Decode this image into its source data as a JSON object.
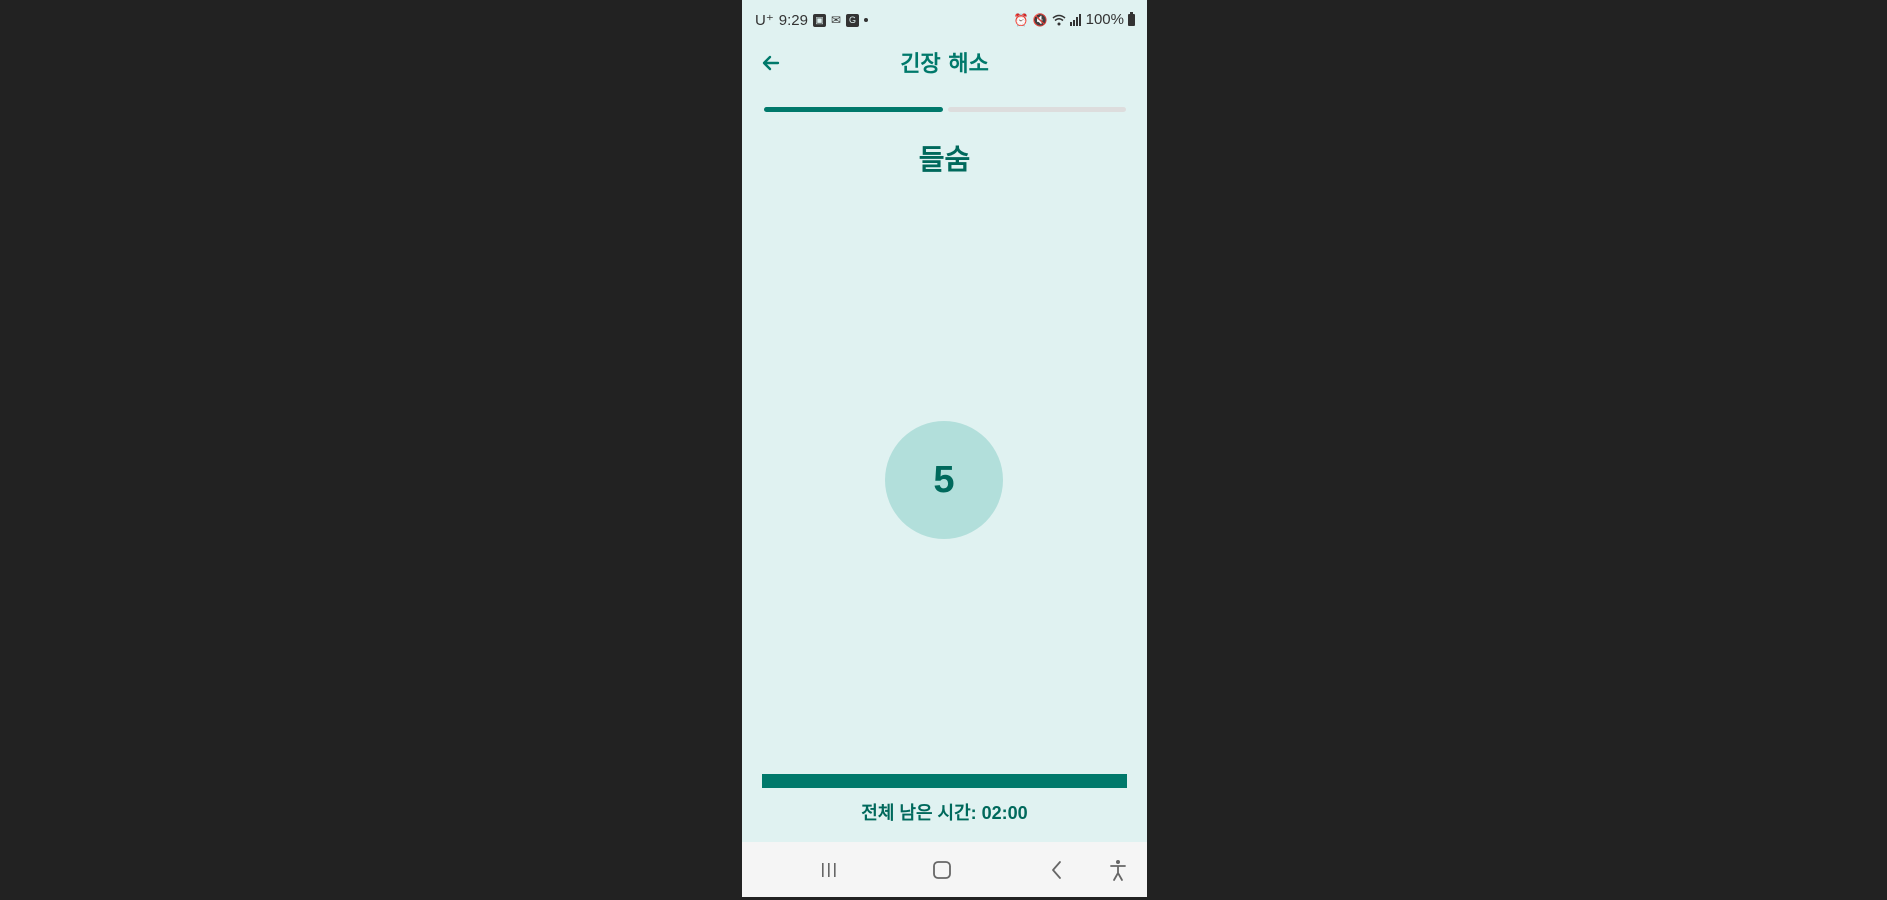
{
  "status_bar": {
    "carrier": "U⁺",
    "time": "9:29",
    "battery": "100%",
    "icons_left": [
      "gallery-icon",
      "mail-icon",
      "app-icon",
      "dot-icon"
    ],
    "icons_right": [
      "alarm-icon",
      "mute-icon",
      "wifi-icon",
      "signal-icon",
      "battery-icon"
    ]
  },
  "app_bar": {
    "title": "긴장 해소",
    "back_icon": "arrow-left-icon"
  },
  "steps": {
    "total": 2,
    "current": 1
  },
  "phase": {
    "label": "들숨"
  },
  "counter": {
    "value": "5"
  },
  "total_progress": {
    "fraction": 1.0,
    "label_prefix": "전체 남은 시간: ",
    "remaining": "02:00",
    "label": "전체 남은 시간: 02:00"
  },
  "nav_bar": {
    "buttons": [
      "recents-icon",
      "home-icon",
      "back-icon",
      "accessibility-icon"
    ]
  },
  "colors": {
    "primary": "#00796b",
    "background": "#e0f2f1",
    "circle": "#b2dfdb",
    "inactive": "#dddddd"
  }
}
